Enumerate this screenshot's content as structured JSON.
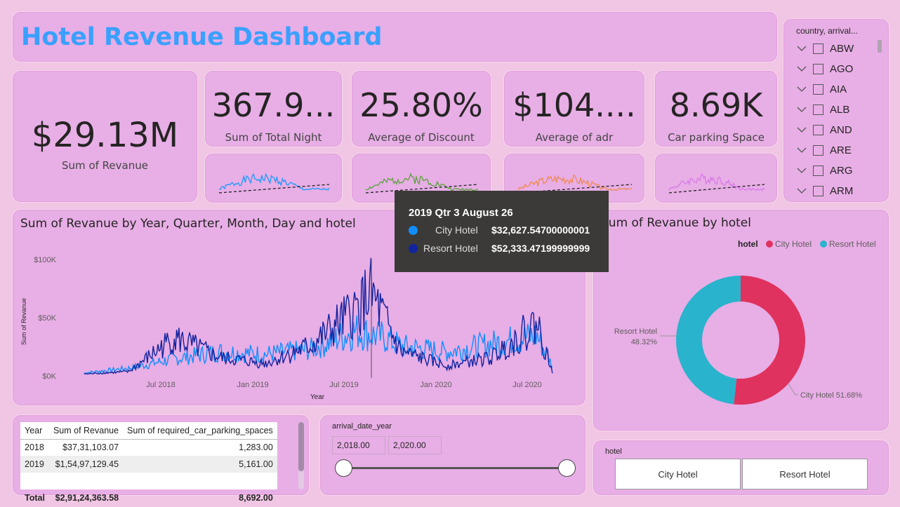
{
  "title": "Hotel Revenue Dashboard",
  "kpis": {
    "revenue": {
      "value": "$29.13M",
      "label": "Sum of Revanue"
    },
    "nights": {
      "value": "367.9...",
      "label": "Sum of Total  Night"
    },
    "discount": {
      "value": "25.80%",
      "label": "Average of Discount"
    },
    "adr": {
      "value": "$104....",
      "label": "Average of adr"
    },
    "parking": {
      "value": "8.69K",
      "label": "Car parking Space"
    }
  },
  "slicer": {
    "header": "country, arrival...",
    "items": [
      "ABW",
      "AGO",
      "AIA",
      "ALB",
      "AND",
      "ARE",
      "ARG",
      "ARM"
    ]
  },
  "line_chart": {
    "title": "Sum of Revanue by Year, Quarter, Month, Day and hotel",
    "ylabel": "Sum of Revanue",
    "xlabel": "Year",
    "yticks": [
      "$100K",
      "$50K",
      "$0K"
    ],
    "xticks": [
      "Jul 2018",
      "Jan 2019",
      "Jul 2019",
      "Jan 2020",
      "Jul 2020"
    ]
  },
  "tooltip": {
    "header": "2019 Qtr 3 August 26",
    "rows": [
      {
        "label": "City Hotel",
        "value": "$32,627.54700000001"
      },
      {
        "label": "Resort Hotel",
        "value": "$52,333.47199999999"
      }
    ]
  },
  "donut": {
    "title": "Sum of Revanue by hotel",
    "legend_title": "hotel",
    "legend": [
      "City Hotel",
      "Resort Hotel"
    ],
    "label_resort": "Resort Hotel",
    "label_resort_pct": "48.32%",
    "label_city": "City Hotel 51.68%"
  },
  "table": {
    "headers": [
      "Year",
      "Sum of Revanue",
      "Sum of required_car_parking_spaces"
    ],
    "rows": [
      [
        "2018",
        "$37,31,103.07",
        "1,283.00"
      ],
      [
        "2019",
        "$1,54,97,129.45",
        "5,161.00"
      ]
    ],
    "total": [
      "Total",
      "$2,91,24,363.58",
      "8,692.00"
    ]
  },
  "year_slicer": {
    "label": "arrival_date_year",
    "from": "2,018.00",
    "to": "2,020.00"
  },
  "hotel_slicer": {
    "label": "hotel",
    "options": [
      "City Hotel",
      "Resort Hotel"
    ]
  },
  "colors": {
    "city": "#118dff",
    "resort": "#12239e",
    "donut_city": "#e0325f",
    "donut_resort": "#2ab3cc"
  },
  "chart_data": [
    {
      "type": "line",
      "title": "Sum of Revanue by Year, Quarter, Month, Day and hotel",
      "xlabel": "Year",
      "ylabel": "Sum of Revanue",
      "x_range": [
        "2017-12",
        "2020-08"
      ],
      "ylim": [
        0,
        100000
      ],
      "series": [
        {
          "name": "City Hotel",
          "x": [
            "2018-01",
            "2018-04",
            "2018-07",
            "2018-10",
            "2019-01",
            "2019-04",
            "2019-07",
            "2019-09",
            "2019-10",
            "2020-01",
            "2020-04",
            "2020-07",
            "2020-08"
          ],
          "values": [
            2000,
            6000,
            14000,
            20000,
            18000,
            22000,
            38000,
            32000,
            25000,
            20000,
            27000,
            34000,
            8000
          ]
        },
        {
          "name": "Resort Hotel",
          "x": [
            "2018-01",
            "2018-04",
            "2018-07",
            "2018-10",
            "2019-01",
            "2019-04",
            "2019-07",
            "2019-08",
            "2019-10",
            "2020-01",
            "2020-04",
            "2020-07",
            "2020-08"
          ],
          "values": [
            1000,
            3000,
            32000,
            15000,
            10000,
            25000,
            55000,
            70000,
            20000,
            8000,
            15000,
            45000,
            3000
          ]
        }
      ]
    },
    {
      "type": "pie",
      "title": "Sum of Revanue by hotel",
      "categories": [
        "City Hotel",
        "Resort Hotel"
      ],
      "values": [
        51.68,
        48.32
      ]
    }
  ]
}
